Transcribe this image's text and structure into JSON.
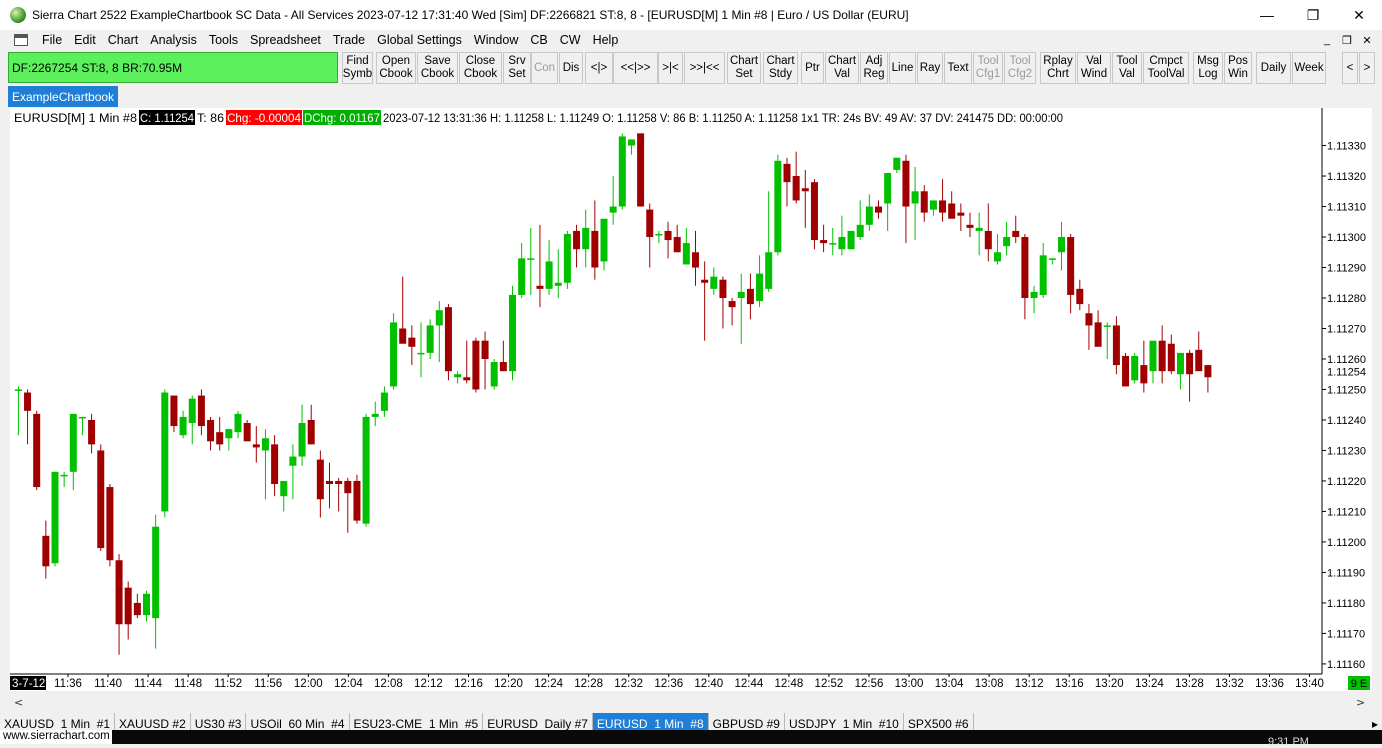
{
  "window": {
    "title": "Sierra Chart 2522 ExampleChartbook SC Data - All Services 2023-07-12  17:31:40 Wed [Sim]  DF:2266821  ST:8, 8 - [EURUSD[M]  1 Min  #8 | Euro / US Dollar (EURU]",
    "minimize": "—",
    "maximize": "❐",
    "close": "✕"
  },
  "menu": [
    "File",
    "Edit",
    "Chart",
    "Analysis",
    "Tools",
    "Spreadsheet",
    "Trade",
    "Global Settings",
    "Window",
    "CB",
    "CW",
    "Help"
  ],
  "mdi_buttons": [
    "_",
    "❐",
    "✕"
  ],
  "status_box": "DF:2267254  ST:8, 8  BR:70.95M",
  "toolbar": [
    {
      "label": "Find\nSymb",
      "name": "find-symbol-button"
    },
    {
      "label": "Open\nCbook",
      "name": "open-chartbook-button"
    },
    {
      "label": "Save\nCbook",
      "name": "save-chartbook-button"
    },
    {
      "label": "Close\nCbook",
      "name": "close-chartbook-button"
    },
    {
      "label": "Srv\nSet",
      "name": "server-settings-button"
    },
    {
      "label": "Con",
      "name": "connect-button",
      "disabled": true
    },
    {
      "label": "Dis",
      "name": "disconnect-button"
    },
    {
      "label": "<|>",
      "name": "scroll-center-button"
    },
    {
      "label": "<<|>>",
      "name": "scroll-both-button"
    },
    {
      "label": ">|<",
      "name": "scroll-collapse-button"
    },
    {
      "label": ">>|<<",
      "name": "scroll-collapse-all-button"
    },
    {
      "label": "Chart\nSet",
      "name": "chart-settings-button"
    },
    {
      "label": "Chart\nStdy",
      "name": "chart-studies-button"
    },
    {
      "label": "Ptr",
      "name": "pointer-button"
    },
    {
      "label": "Chart\nVal",
      "name": "chart-values-button"
    },
    {
      "label": "Adj\nReg",
      "name": "adjust-region-button"
    },
    {
      "label": "Line",
      "name": "line-tool-button"
    },
    {
      "label": "Ray",
      "name": "ray-tool-button"
    },
    {
      "label": "Text",
      "name": "text-tool-button"
    },
    {
      "label": "Tool\nCfg1",
      "name": "tool-config1-button",
      "disabled": true
    },
    {
      "label": "Tool\nCfg2",
      "name": "tool-config2-button",
      "disabled": true
    },
    {
      "label": "Rplay\nChrt",
      "name": "replay-chart-button"
    },
    {
      "label": "Val\nWind",
      "name": "values-window-button"
    },
    {
      "label": "Tool\nVal",
      "name": "tool-values-button"
    },
    {
      "label": "Cmpct\nToolVal",
      "name": "compact-tool-values-button"
    },
    {
      "label": "Msg\nLog",
      "name": "message-log-button"
    },
    {
      "label": "Pos\nWin",
      "name": "position-window-button"
    },
    {
      "label": "Daily",
      "name": "daily-button"
    },
    {
      "label": "Week",
      "name": "week-button"
    },
    {
      "label": "<",
      "name": "toolbar-scroll-left-button"
    },
    {
      "label": ">",
      "name": "toolbar-scroll-right-button"
    }
  ],
  "chartbook_tab": "ExampleChartbook",
  "chart_header": {
    "symbol": "EURUSD[M]  1 Min  #8",
    "close": "C: 1.11254",
    "ticks": "T: 86",
    "chg": "Chg: -0.00004",
    "dchg": "DChg: 0.01167",
    "info": "2023-07-12 13:31:36 H: 1.11258 L: 1.11249 O: 1.11258 V: 86 B: 1.11250 A: 1.11258 1x1 TR: 24s BV: 49 AV: 37 DV: 241475 DD: 00:00:00"
  },
  "price_axis": {
    "ticks": [
      "1.11330",
      "1.11320",
      "1.11310",
      "1.11300",
      "1.11290",
      "1.11280",
      "1.11270",
      "1.11260",
      "1.11250",
      "1.11240",
      "1.11230",
      "1.11220",
      "1.11210",
      "1.11200",
      "1.11190",
      "1.11180",
      "1.11170",
      "1.11160"
    ],
    "current_price": "1.11254"
  },
  "time_axis": {
    "start_label": "3-7-12",
    "ticks": [
      "11:36",
      "11:40",
      "11:44",
      "11:48",
      "11:52",
      "11:56",
      "12:00",
      "12:04",
      "12:08",
      "12:12",
      "12:16",
      "12:20",
      "12:24",
      "12:28",
      "12:32",
      "12:36",
      "12:40",
      "12:44",
      "12:48",
      "12:52",
      "12:56",
      "13:00",
      "13:04",
      "13:08",
      "13:12",
      "13:16",
      "13:20",
      "13:24",
      "13:28",
      "13:32",
      "13:36",
      "13:40"
    ],
    "corner_badge": "9 E"
  },
  "chart_data": {
    "type": "candlestick",
    "ylim": [
      1.11158,
      1.11341
    ],
    "candles": [
      [
        1.1125,
        1.11251,
        1.11235,
        1.1125
      ],
      [
        1.11249,
        1.1125,
        1.11232,
        1.11243
      ],
      [
        1.11242,
        1.11243,
        1.11217,
        1.11218
      ],
      [
        1.11202,
        1.11207,
        1.11188,
        1.11192
      ],
      [
        1.11193,
        1.11223,
        1.11192,
        1.11223
      ],
      [
        1.11222,
        1.11223,
        1.11218,
        1.11222
      ],
      [
        1.11223,
        1.11242,
        1.11217,
        1.11242
      ],
      [
        1.11241,
        1.11241,
        1.11235,
        1.11241
      ],
      [
        1.1124,
        1.11242,
        1.11229,
        1.11232
      ],
      [
        1.1123,
        1.11232,
        1.11197,
        1.11198
      ],
      [
        1.11218,
        1.11219,
        1.11192,
        1.11194
      ],
      [
        1.11194,
        1.11196,
        1.11163,
        1.11173
      ],
      [
        1.11185,
        1.11187,
        1.11168,
        1.11173
      ],
      [
        1.1118,
        1.11183,
        1.11175,
        1.11176
      ],
      [
        1.11176,
        1.11184,
        1.11174,
        1.11183
      ],
      [
        1.11175,
        1.11209,
        1.11165,
        1.11205
      ],
      [
        1.1121,
        1.1125,
        1.11208,
        1.11249
      ],
      [
        1.11248,
        1.11248,
        1.11236,
        1.11238
      ],
      [
        1.11235,
        1.11243,
        1.11234,
        1.11241
      ],
      [
        1.11239,
        1.11248,
        1.11232,
        1.11247
      ],
      [
        1.11248,
        1.1125,
        1.11235,
        1.11238
      ],
      [
        1.1124,
        1.11241,
        1.1123,
        1.11233
      ],
      [
        1.11236,
        1.11241,
        1.1123,
        1.11232
      ],
      [
        1.11234,
        1.11237,
        1.1123,
        1.11237
      ],
      [
        1.11236,
        1.11243,
        1.11234,
        1.11242
      ],
      [
        1.11239,
        1.1124,
        1.11233,
        1.11233
      ],
      [
        1.11232,
        1.11238,
        1.11226,
        1.11231
      ],
      [
        1.1123,
        1.11237,
        1.11214,
        1.11234
      ],
      [
        1.11232,
        1.11235,
        1.11215,
        1.11219
      ],
      [
        1.11215,
        1.1122,
        1.1121,
        1.1122
      ],
      [
        1.11225,
        1.11232,
        1.11214,
        1.11228
      ],
      [
        1.11228,
        1.11245,
        1.11225,
        1.11239
      ],
      [
        1.1124,
        1.11245,
        1.11232,
        1.11232
      ],
      [
        1.11227,
        1.1123,
        1.11208,
        1.11214
      ],
      [
        1.1122,
        1.11226,
        1.11211,
        1.11219
      ],
      [
        1.1122,
        1.11221,
        1.1121,
        1.11219
      ],
      [
        1.1122,
        1.11221,
        1.11203,
        1.11216
      ],
      [
        1.1122,
        1.11222,
        1.11206,
        1.11207
      ],
      [
        1.11206,
        1.11242,
        1.11205,
        1.11241
      ],
      [
        1.11241,
        1.11246,
        1.11238,
        1.11242
      ],
      [
        1.11243,
        1.11251,
        1.11241,
        1.11249
      ],
      [
        1.11251,
        1.11275,
        1.1125,
        1.11272
      ],
      [
        1.1127,
        1.11287,
        1.11266,
        1.11265
      ],
      [
        1.11267,
        1.11271,
        1.11258,
        1.11264
      ],
      [
        1.11262,
        1.11272,
        1.11254,
        1.11262
      ],
      [
        1.11262,
        1.11273,
        1.1126,
        1.11271
      ],
      [
        1.11271,
        1.11279,
        1.11259,
        1.11276
      ],
      [
        1.11277,
        1.11278,
        1.11253,
        1.11256
      ],
      [
        1.11254,
        1.11256,
        1.11252,
        1.11255
      ],
      [
        1.11254,
        1.11266,
        1.11252,
        1.11253
      ],
      [
        1.11266,
        1.11267,
        1.11249,
        1.1125
      ],
      [
        1.11266,
        1.11269,
        1.1125,
        1.1126
      ],
      [
        1.11251,
        1.1126,
        1.1125,
        1.11259
      ],
      [
        1.11259,
        1.11266,
        1.11256,
        1.11256
      ],
      [
        1.11256,
        1.11284,
        1.11253,
        1.11281
      ],
      [
        1.11281,
        1.11298,
        1.1128,
        1.11293
      ],
      [
        1.11293,
        1.11303,
        1.11281,
        1.11293
      ],
      [
        1.11284,
        1.11304,
        1.11277,
        1.11283
      ],
      [
        1.11283,
        1.11299,
        1.11281,
        1.11292
      ],
      [
        1.11284,
        1.11296,
        1.1128,
        1.11285
      ],
      [
        1.11285,
        1.11302,
        1.11283,
        1.11301
      ],
      [
        1.11302,
        1.11304,
        1.1129,
        1.11296
      ],
      [
        1.11296,
        1.11309,
        1.1129,
        1.11303
      ],
      [
        1.11302,
        1.11312,
        1.11286,
        1.1129
      ],
      [
        1.11292,
        1.11304,
        1.11289,
        1.11306
      ],
      [
        1.11308,
        1.1132,
        1.11304,
        1.1131
      ],
      [
        1.1131,
        1.11334,
        1.11309,
        1.11333
      ],
      [
        1.1133,
        1.11332,
        1.11327,
        1.11332
      ],
      [
        1.11334,
        1.11334,
        1.1131,
        1.1131
      ],
      [
        1.11309,
        1.11311,
        1.1129,
        1.113
      ],
      [
        1.11301,
        1.11302,
        1.11298,
        1.11301
      ],
      [
        1.11302,
        1.11305,
        1.11293,
        1.11299
      ],
      [
        1.113,
        1.11304,
        1.11298,
        1.11295
      ],
      [
        1.11291,
        1.11303,
        1.11291,
        1.11298
      ],
      [
        1.11295,
        1.11302,
        1.11284,
        1.1129
      ],
      [
        1.11286,
        1.11292,
        1.11266,
        1.11285
      ],
      [
        1.11283,
        1.1129,
        1.11281,
        1.11287
      ],
      [
        1.11286,
        1.11287,
        1.1127,
        1.1128
      ],
      [
        1.11279,
        1.1128,
        1.11271,
        1.11277
      ],
      [
        1.1128,
        1.11288,
        1.11265,
        1.11282
      ],
      [
        1.11283,
        1.11288,
        1.11273,
        1.11278
      ],
      [
        1.11279,
        1.11294,
        1.11277,
        1.11288
      ],
      [
        1.11283,
        1.11315,
        1.11282,
        1.11295
      ],
      [
        1.11295,
        1.11327,
        1.11294,
        1.11325
      ],
      [
        1.11324,
        1.11326,
        1.1131,
        1.11318
      ],
      [
        1.1132,
        1.11328,
        1.11311,
        1.11312
      ],
      [
        1.11316,
        1.11322,
        1.11303,
        1.11315
      ],
      [
        1.11318,
        1.11319,
        1.11296,
        1.11299
      ],
      [
        1.11299,
        1.11304,
        1.11295,
        1.11298
      ],
      [
        1.11298,
        1.11303,
        1.11294,
        1.11298
      ],
      [
        1.11296,
        1.11307,
        1.11294,
        1.113
      ],
      [
        1.11296,
        1.11302,
        1.11296,
        1.11302
      ],
      [
        1.113,
        1.11312,
        1.11299,
        1.11304
      ],
      [
        1.11304,
        1.11314,
        1.11302,
        1.1131
      ],
      [
        1.1131,
        1.11312,
        1.11306,
        1.11308
      ],
      [
        1.11311,
        1.11321,
        1.11302,
        1.11321
      ],
      [
        1.11322,
        1.11326,
        1.11321,
        1.11326
      ],
      [
        1.11325,
        1.11327,
        1.11298,
        1.1131
      ],
      [
        1.11311,
        1.11323,
        1.11299,
        1.11315
      ],
      [
        1.11315,
        1.11317,
        1.11305,
        1.11308
      ],
      [
        1.11309,
        1.11312,
        1.11307,
        1.11312
      ],
      [
        1.11312,
        1.11319,
        1.11305,
        1.11308
      ],
      [
        1.11311,
        1.11315,
        1.11307,
        1.11306
      ],
      [
        1.11308,
        1.11311,
        1.11302,
        1.11307
      ],
      [
        1.11304,
        1.11308,
        1.113,
        1.11303
      ],
      [
        1.11302,
        1.11308,
        1.11294,
        1.11303
      ],
      [
        1.11302,
        1.11311,
        1.11292,
        1.11296
      ],
      [
        1.11292,
        1.11301,
        1.11291,
        1.11295
      ],
      [
        1.11297,
        1.11305,
        1.11294,
        1.113
      ],
      [
        1.11302,
        1.11307,
        1.11298,
        1.113
      ],
      [
        1.113,
        1.11301,
        1.11273,
        1.1128
      ],
      [
        1.1128,
        1.11284,
        1.11275,
        1.11282
      ],
      [
        1.11281,
        1.11298,
        1.1128,
        1.11294
      ],
      [
        1.11293,
        1.11293,
        1.11291,
        1.11293
      ],
      [
        1.11295,
        1.11305,
        1.11289,
        1.113
      ],
      [
        1.113,
        1.11301,
        1.11275,
        1.11281
      ],
      [
        1.11283,
        1.11286,
        1.11276,
        1.11278
      ],
      [
        1.11275,
        1.11278,
        1.11263,
        1.11271
      ],
      [
        1.11272,
        1.11276,
        1.11265,
        1.11264
      ],
      [
        1.11271,
        1.11272,
        1.1126,
        1.11271
      ],
      [
        1.11271,
        1.11274,
        1.11255,
        1.11258
      ],
      [
        1.11261,
        1.11262,
        1.11251,
        1.11251
      ],
      [
        1.11253,
        1.11262,
        1.11252,
        1.11261
      ],
      [
        1.11258,
        1.11266,
        1.11249,
        1.11252
      ],
      [
        1.11256,
        1.11265,
        1.11252,
        1.11266
      ],
      [
        1.11266,
        1.11271,
        1.11252,
        1.11256
      ],
      [
        1.11265,
        1.11268,
        1.11255,
        1.11256
      ],
      [
        1.11255,
        1.11262,
        1.1125,
        1.11262
      ],
      [
        1.11262,
        1.11263,
        1.11246,
        1.11255
      ],
      [
        1.11263,
        1.11269,
        1.11258,
        1.11256
      ],
      [
        1.11258,
        1.11258,
        1.11249,
        1.11254
      ]
    ]
  },
  "bottom_tabs": [
    {
      "label": "XAUUSD  1 Min  #1"
    },
    {
      "label": "XAUUSD #2"
    },
    {
      "label": "US30 #3"
    },
    {
      "label": "USOil  60 Min  #4"
    },
    {
      "label": "ESU23-CME  1 Min  #5"
    },
    {
      "label": "EURUSD  Daily #7"
    },
    {
      "label": "EURUSD  1 Min  #8",
      "active": true
    },
    {
      "label": "GBPUSD #9"
    },
    {
      "label": "USDJPY  1 Min  #10"
    },
    {
      "label": "SPX500 #6"
    }
  ],
  "footer": {
    "site": "www.sierrachart.com",
    "clock": "9:31 PM"
  },
  "colors": {
    "up": "#00c000",
    "down": "#a00000",
    "status_green": "#5cf05c",
    "tab_blue": "#1f7fd6"
  }
}
